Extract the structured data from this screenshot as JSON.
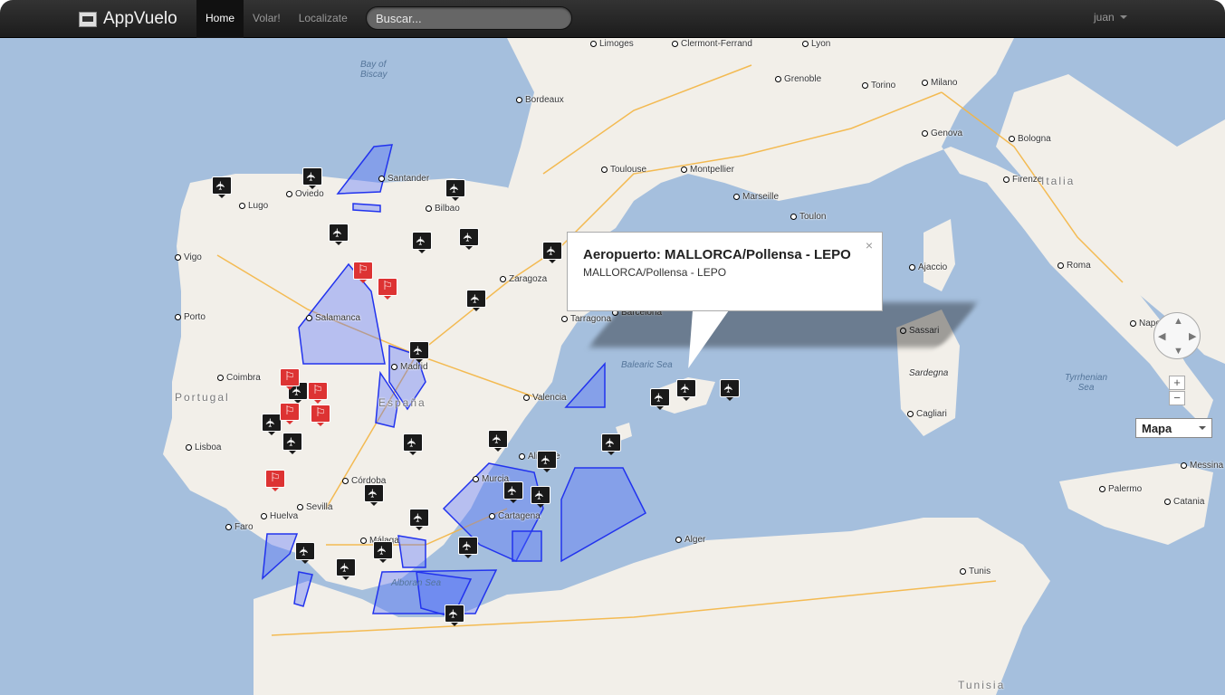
{
  "app": {
    "brand": "AppVuelo"
  },
  "nav": {
    "home": "Home",
    "volar": "Volar!",
    "localizate": "Localizate"
  },
  "search": {
    "placeholder": "Buscar..."
  },
  "user": {
    "name": "juan"
  },
  "map": {
    "places": {
      "bay_of_biscay": "Bay of\nBiscay",
      "limoges": "Limoges",
      "clermont": "Clermont-Ferrand",
      "lyon": "Lyon",
      "grenoble": "Grenoble",
      "torino": "Torino",
      "milano": "Milano",
      "bordeaux": "Bordeaux",
      "toulouse": "Toulouse",
      "montpellier": "Montpellier",
      "marseille": "Marseille",
      "toulon": "Toulon",
      "genova": "Genova",
      "bologna": "Bologna",
      "firenze": "Firenze",
      "italia": "Italia",
      "roma": "Roma",
      "napoli": "Napoli",
      "bilbao": "Bilbao",
      "santander": "Santander",
      "zaragoza": "Zaragoza",
      "barcelona": "Barcelona",
      "tarragona": "Tarragona",
      "madrid": "Madrid",
      "espana": "España",
      "valencia": "Valencia",
      "alicante": "Alicante",
      "murcia": "Murcia",
      "cartagena": "Cartagena",
      "cordoba": "Córdoba",
      "sevilla": "Sevilla",
      "malaga": "Málaga",
      "huelva": "Huelva",
      "faro": "Faro",
      "lisboa": "Lisboa",
      "portugal": "Portugal",
      "porto": "Porto",
      "coimbra": "Coimbra",
      "salamanca": "Salamanca",
      "vigo": "Vigo",
      "lugo": "Lugo",
      "oviedo": "Oviedo",
      "balearic_sea": "Balearic Sea",
      "alboran_sea": "Alboran Sea",
      "tyrrhenian_sea": "Tyrrhenian\nSea",
      "sardegna": "Sardegna",
      "alger": "Alger",
      "tunis": "Tunis",
      "palermo": "Palermo",
      "catania": "Catania",
      "messina": "Messina",
      "cagliari": "Cagliari",
      "sassari": "Sassari",
      "ajaccio": "Ajaccio",
      "tunisia": "Tunisia"
    },
    "info_window": {
      "title": "Aeropuerto: MALLORCA/Pollensa - LEPO",
      "subtitle": "MALLORCA/Pollensa - LEPO",
      "close": "×"
    },
    "zoom": {
      "in": "+",
      "out": "−"
    },
    "map_type": "Mapa",
    "colors": {
      "water": "#a5bfdd",
      "land": "#f2efe9",
      "zones": "#4a66ff",
      "marker": "#1a1a1a",
      "marker_alt": "#d33333"
    }
  }
}
